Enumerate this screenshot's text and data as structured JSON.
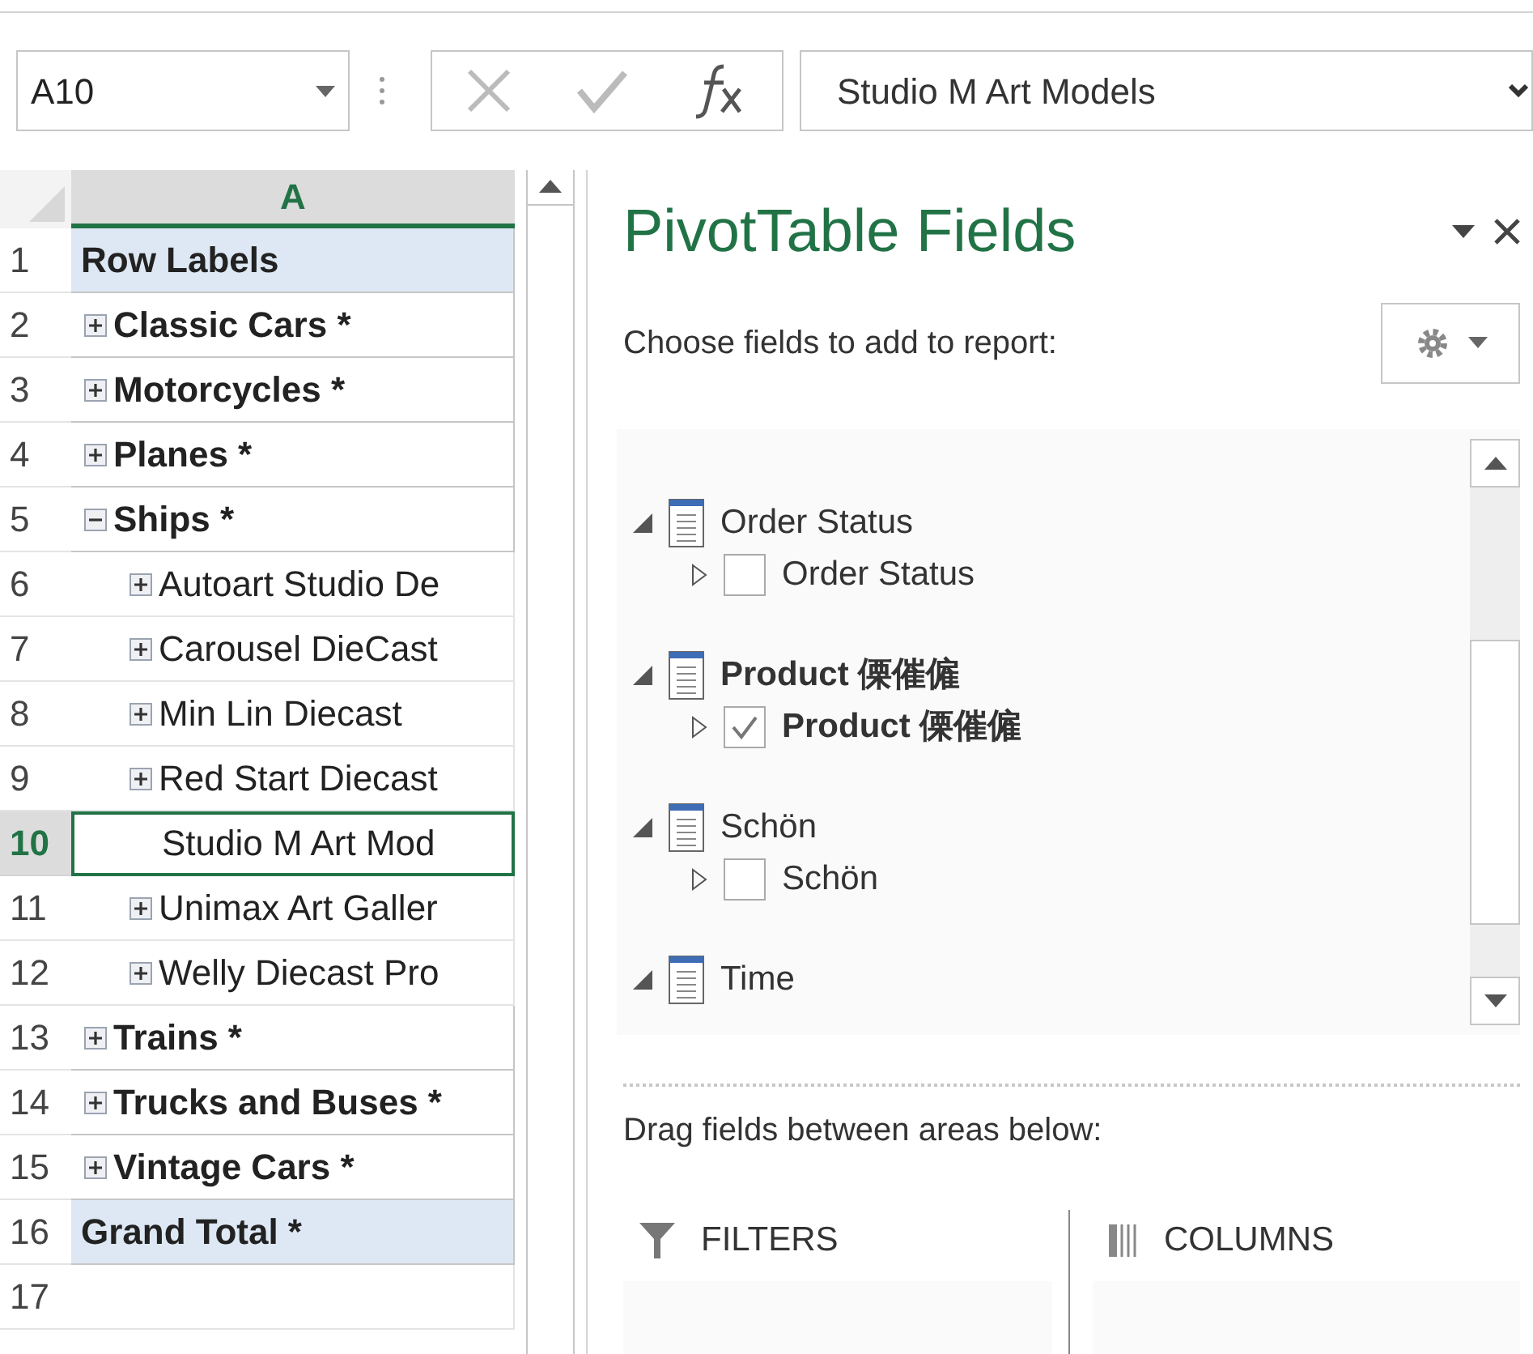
{
  "formula_bar": {
    "name_box": "A10",
    "formula": "Studio M Art Models"
  },
  "sheet": {
    "column_header": "A",
    "rows": [
      {
        "number": "1",
        "label": "Row Labels",
        "kind": "header",
        "selected": false
      },
      {
        "number": "2",
        "label": "Classic Cars *",
        "kind": "group",
        "expanded": false,
        "selected": false
      },
      {
        "number": "3",
        "label": "Motorcycles *",
        "kind": "group",
        "expanded": false,
        "selected": false
      },
      {
        "number": "4",
        "label": "Planes *",
        "kind": "group",
        "expanded": false,
        "selected": false
      },
      {
        "number": "5",
        "label": "Ships *",
        "kind": "group",
        "expanded": true,
        "selected": false
      },
      {
        "number": "6",
        "label": "Autoart Studio De",
        "kind": "item",
        "expanded": false,
        "selected": false
      },
      {
        "number": "7",
        "label": "Carousel DieCast",
        "kind": "item",
        "expanded": false,
        "selected": false
      },
      {
        "number": "8",
        "label": "Min Lin Diecast",
        "kind": "item",
        "expanded": false,
        "selected": false
      },
      {
        "number": "9",
        "label": "Red Start Diecast",
        "kind": "item",
        "expanded": false,
        "selected": false
      },
      {
        "number": "10",
        "label": "Studio M Art Mod",
        "kind": "leaf",
        "selected": true
      },
      {
        "number": "11",
        "label": "Unimax Art Galler",
        "kind": "item",
        "expanded": false,
        "selected": false
      },
      {
        "number": "12",
        "label": "Welly Diecast Pro",
        "kind": "item",
        "expanded": false,
        "selected": false
      },
      {
        "number": "13",
        "label": "Trains *",
        "kind": "group",
        "expanded": false,
        "selected": false
      },
      {
        "number": "14",
        "label": "Trucks and Buses *",
        "kind": "group",
        "expanded": false,
        "selected": false
      },
      {
        "number": "15",
        "label": "Vintage Cars *",
        "kind": "group",
        "expanded": false,
        "selected": false
      },
      {
        "number": "16",
        "label": "Grand Total *",
        "kind": "total",
        "selected": false
      },
      {
        "number": "17",
        "kind": "empty",
        "selected": false
      }
    ]
  },
  "pivot_panel": {
    "title": "PivotTable Fields",
    "prompt": "Choose fields to add to report:",
    "fields": [
      {
        "name": "Order Status",
        "expanded": true,
        "children": [
          {
            "name": "Order Status",
            "checked": false
          }
        ]
      },
      {
        "name": "Product 傈催僱",
        "expanded": true,
        "children": [
          {
            "name": "Product 傈催僱",
            "checked": true
          }
        ]
      },
      {
        "name": "Schön",
        "expanded": true,
        "children": [
          {
            "name": "Schön",
            "checked": false
          }
        ]
      },
      {
        "name": "Time",
        "expanded": true
      }
    ],
    "areas_prompt": "Drag fields between areas below:",
    "areas": [
      {
        "kind": "filters",
        "label": "FILTERS"
      },
      {
        "kind": "columns",
        "label": "COLUMNS"
      }
    ]
  }
}
